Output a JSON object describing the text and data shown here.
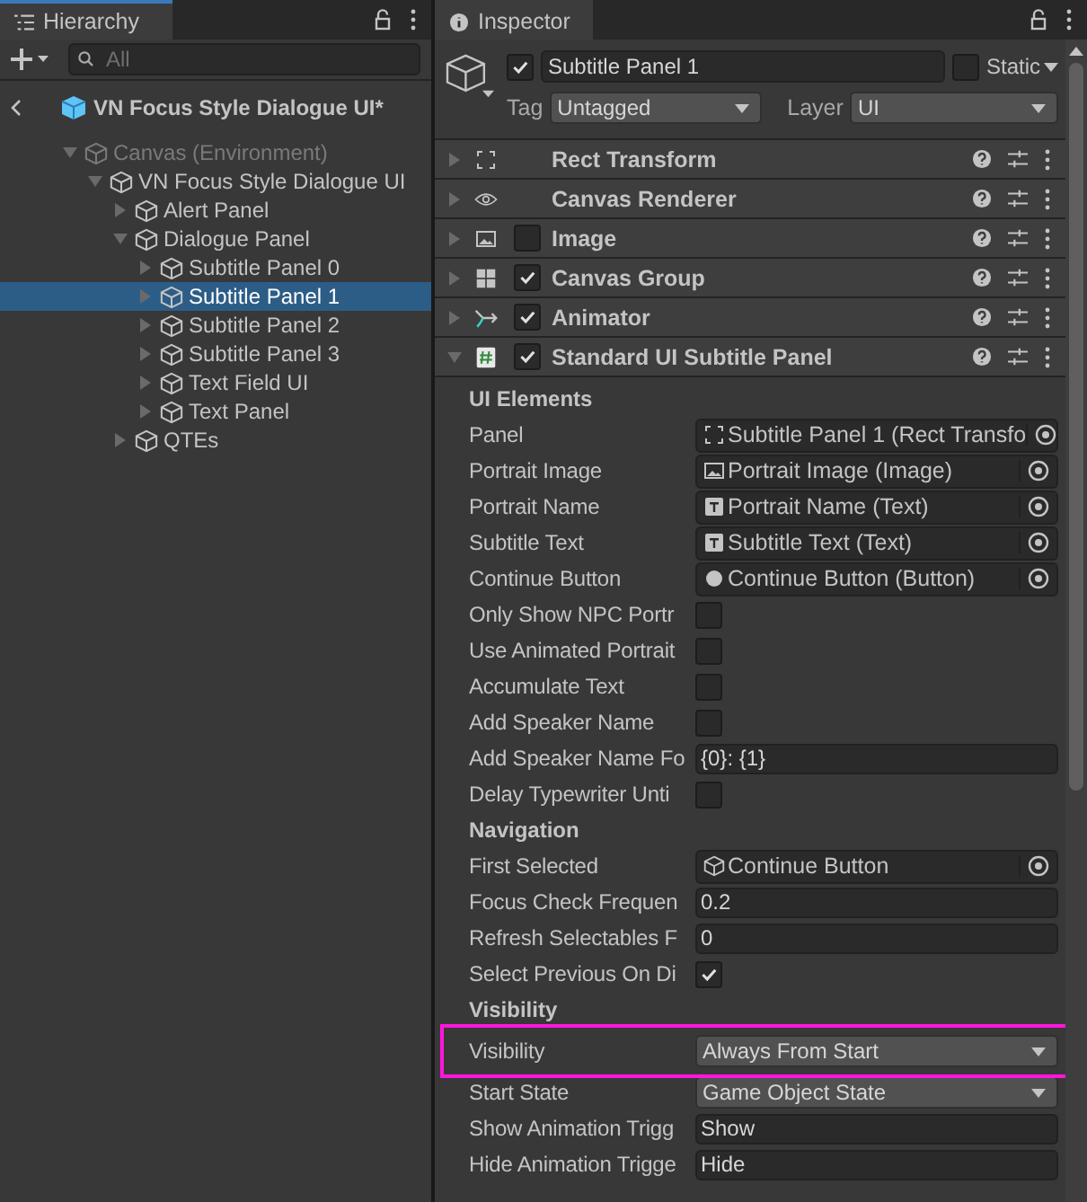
{
  "hierarchy": {
    "tab": "Hierarchy",
    "search": {
      "placeholder": "All"
    },
    "scene": "VN Focus Style Dialogue UI*",
    "tree": [
      {
        "label": "Canvas (Environment)",
        "disabled": true,
        "expanded": true,
        "selected": false,
        "children": [
          {
            "label": "VN Focus Style Dialogue UI",
            "disabled": false,
            "expanded": true,
            "selected": false,
            "children": [
              {
                "label": "Alert Panel",
                "disabled": false,
                "expanded": false,
                "selected": false
              },
              {
                "label": "Dialogue Panel",
                "disabled": false,
                "expanded": true,
                "selected": false,
                "children": [
                  {
                    "label": "Subtitle Panel 0",
                    "disabled": false,
                    "expanded": false,
                    "selected": false
                  },
                  {
                    "label": "Subtitle Panel 1",
                    "disabled": false,
                    "expanded": false,
                    "selected": true
                  },
                  {
                    "label": "Subtitle Panel 2",
                    "disabled": false,
                    "expanded": false,
                    "selected": false
                  },
                  {
                    "label": "Subtitle Panel 3",
                    "disabled": false,
                    "expanded": false,
                    "selected": false
                  },
                  {
                    "label": "Text Field UI",
                    "disabled": false,
                    "expanded": false,
                    "selected": false
                  },
                  {
                    "label": "Text Panel",
                    "disabled": false,
                    "expanded": false,
                    "selected": false
                  }
                ]
              },
              {
                "label": "QTEs",
                "disabled": false,
                "expanded": false,
                "selected": false
              }
            ]
          }
        ]
      }
    ]
  },
  "inspector": {
    "tab": "Inspector",
    "object": {
      "active": true,
      "name": "Subtitle Panel 1",
      "static": false,
      "static_label": "Static",
      "tag_label": "Tag",
      "tag": "Untagged",
      "layer_label": "Layer",
      "layer": "UI"
    },
    "components": [
      {
        "name": "Rect Transform",
        "kind": "fixed",
        "expanded": false
      },
      {
        "name": "Canvas Renderer",
        "kind": "fixed",
        "expanded": false
      },
      {
        "name": "Image",
        "kind": "toggle",
        "enabled": false,
        "expanded": false
      },
      {
        "name": "Canvas Group",
        "kind": "toggle",
        "enabled": true,
        "expanded": false
      },
      {
        "name": "Animator",
        "kind": "toggle",
        "enabled": true,
        "expanded": false
      },
      {
        "name": "Standard UI Subtitle Panel",
        "kind": "toggle",
        "enabled": true,
        "expanded": true
      }
    ],
    "sections": [
      {
        "title": "UI Elements",
        "fields": [
          {
            "label": "Panel",
            "kind": "object",
            "value": "Subtitle Panel 1 (Rect Transfo",
            "highlighted": false
          },
          {
            "label": "Portrait Image",
            "kind": "object",
            "value": "Portrait Image (Image)",
            "highlighted": false
          },
          {
            "label": "Portrait Name",
            "kind": "object",
            "value": "Portrait Name (Text)",
            "highlighted": false
          },
          {
            "label": "Subtitle Text",
            "kind": "object",
            "value": "Subtitle Text (Text)",
            "highlighted": false
          },
          {
            "label": "Continue Button",
            "kind": "object",
            "value": "Continue Button (Button)",
            "highlighted": false
          },
          {
            "label": "Only Show NPC Portr",
            "kind": "checkbox",
            "checked": false,
            "highlighted": false
          },
          {
            "label": "Use Animated Portrait",
            "kind": "checkbox",
            "checked": false,
            "highlighted": false
          },
          {
            "label": "Accumulate Text",
            "kind": "checkbox",
            "checked": false,
            "highlighted": false
          },
          {
            "label": "Add Speaker Name",
            "kind": "checkbox",
            "checked": false,
            "highlighted": false
          },
          {
            "label": "Add Speaker Name Fo",
            "kind": "text",
            "value": "{0}: {1}",
            "highlighted": false
          },
          {
            "label": "Delay Typewriter Unti",
            "kind": "checkbox",
            "checked": false,
            "highlighted": false
          }
        ]
      },
      {
        "title": "Navigation",
        "fields": [
          {
            "label": "First Selected",
            "kind": "object",
            "value": "Continue Button",
            "highlighted": false
          },
          {
            "label": "Focus Check Frequen",
            "kind": "text",
            "value": "0.2",
            "highlighted": false
          },
          {
            "label": "Refresh Selectables F",
            "kind": "text",
            "value": "0",
            "highlighted": false
          },
          {
            "label": "Select Previous On Di",
            "kind": "checkbox",
            "checked": true,
            "highlighted": false
          }
        ]
      },
      {
        "title": "Visibility",
        "fields": [
          {
            "label": "Visibility",
            "kind": "dropdown",
            "value": "Always From Start",
            "highlighted": true
          },
          {
            "label": "Start State",
            "kind": "dropdown",
            "value": "Game Object State",
            "highlighted": false
          },
          {
            "label": "Show Animation Trigg",
            "kind": "text",
            "value": "Show",
            "highlighted": false
          },
          {
            "label": "Hide Animation Trigge",
            "kind": "text",
            "value": "Hide",
            "highlighted": false
          }
        ]
      }
    ]
  }
}
